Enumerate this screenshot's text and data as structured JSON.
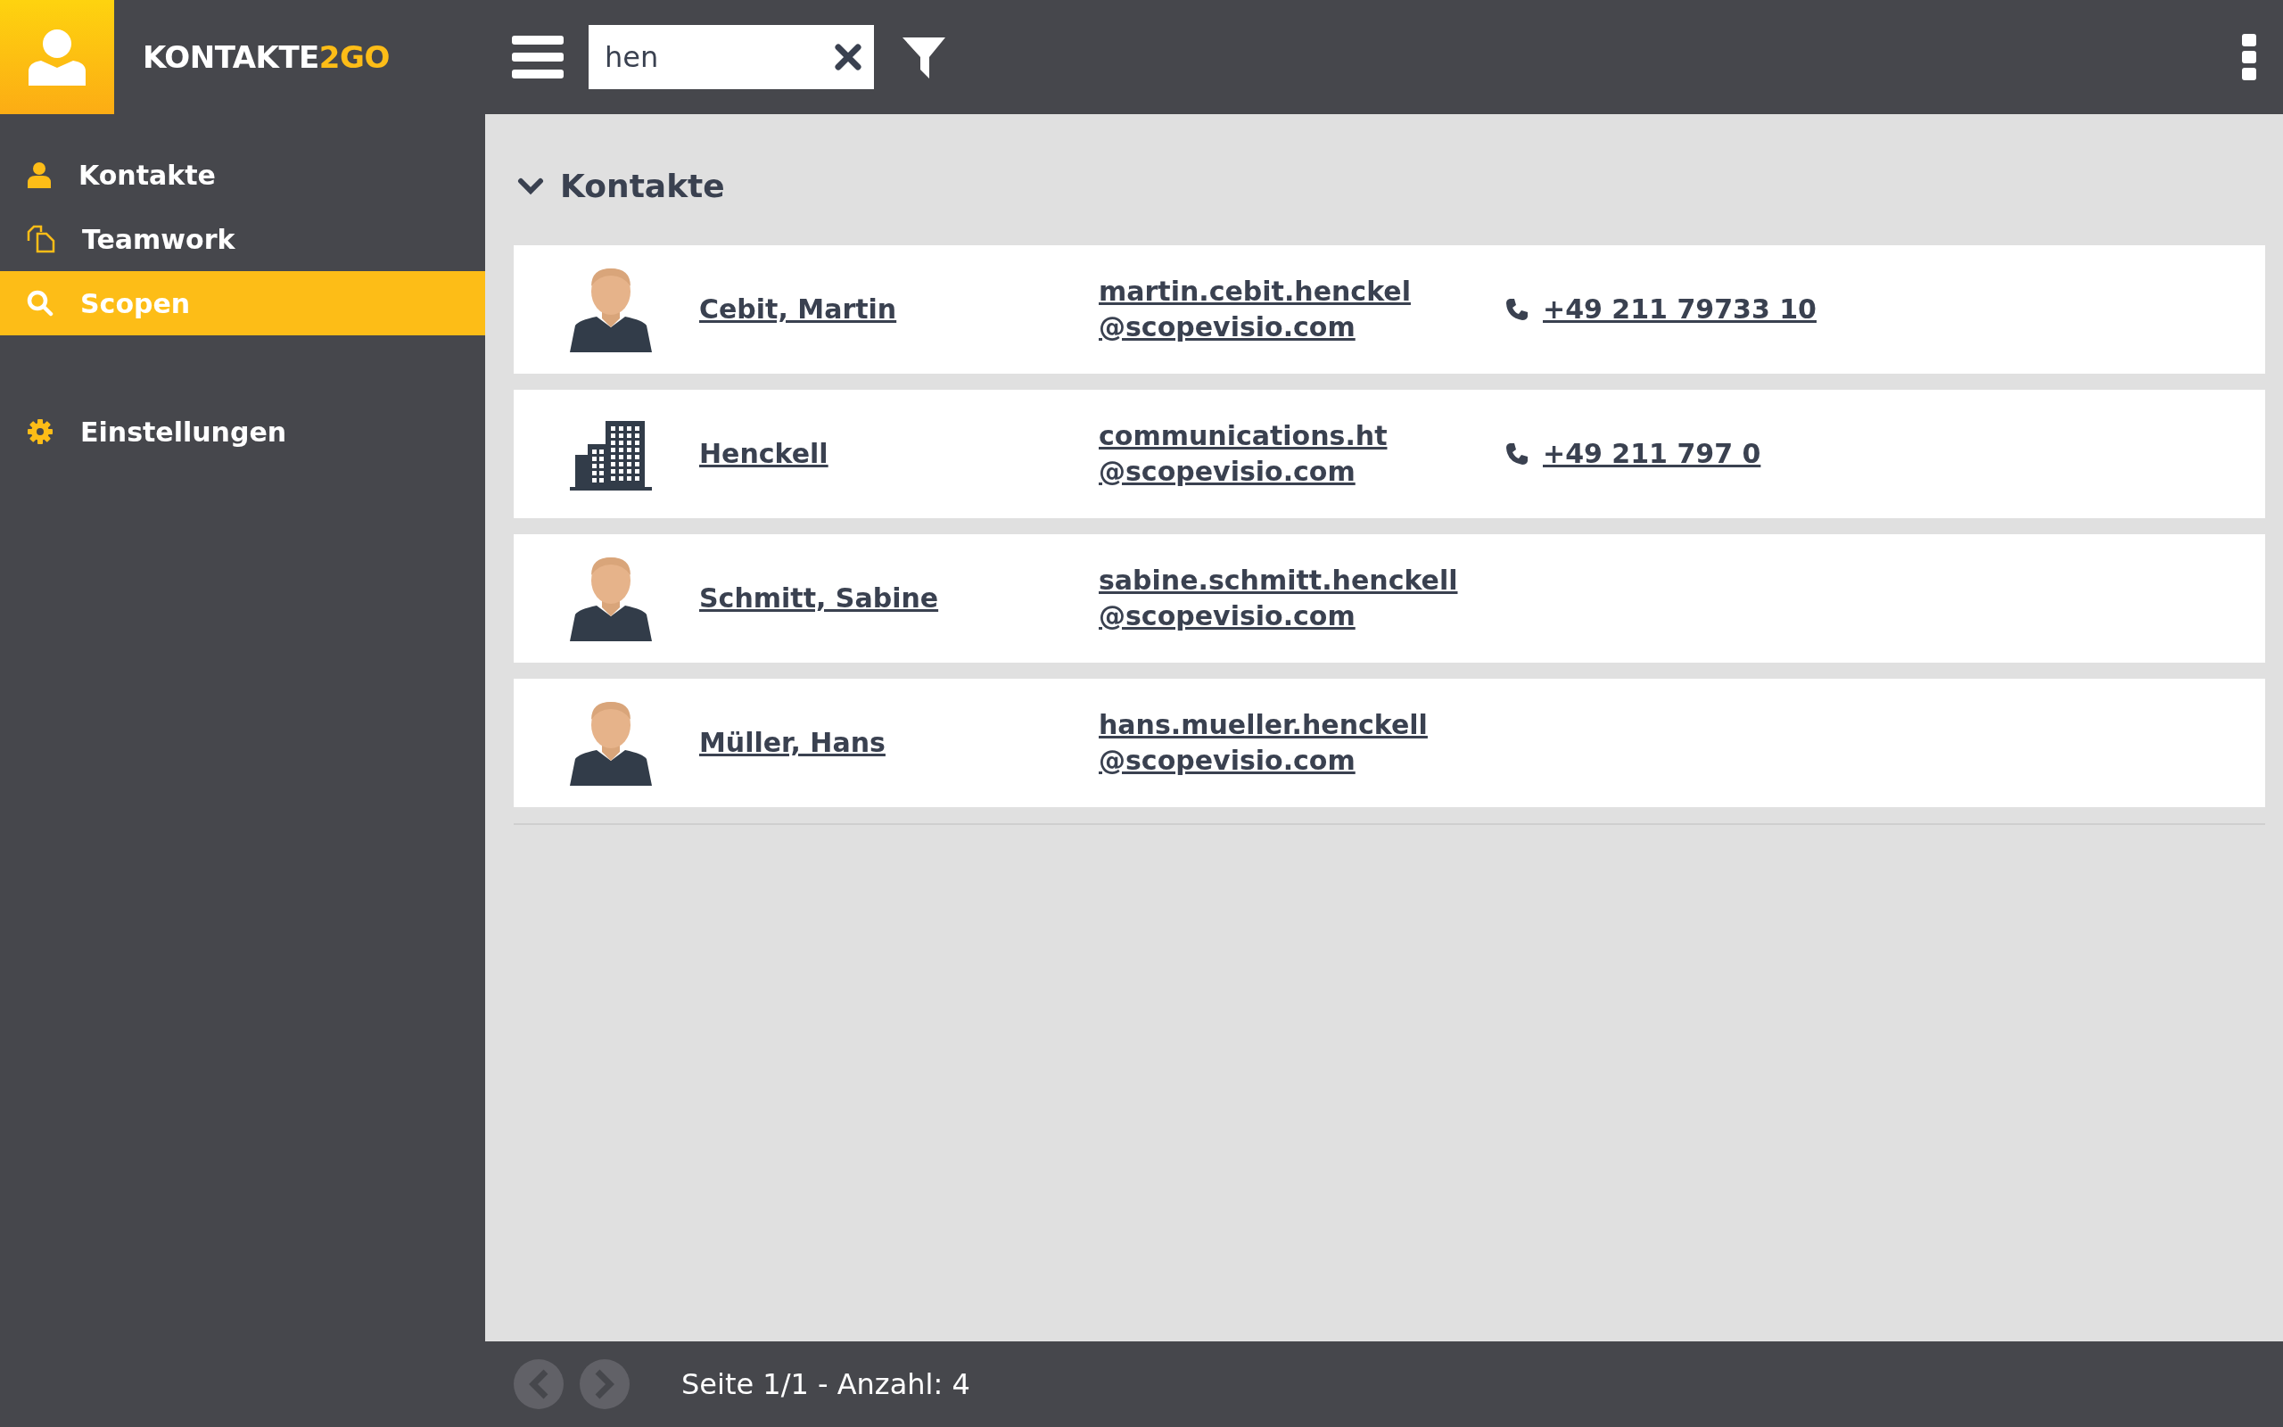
{
  "app": {
    "name": "KONTAKTE",
    "name_accent": "2GO"
  },
  "sidebar": {
    "items": [
      {
        "label": "Kontakte",
        "selected": false
      },
      {
        "label": "Teamwork",
        "selected": false
      },
      {
        "label": "Scopen",
        "selected": true
      },
      {
        "label": "Einstellungen",
        "selected": false,
        "separated": true
      }
    ]
  },
  "search": {
    "value": "hen"
  },
  "section": {
    "title": "Kontakte",
    "expanded": true
  },
  "contacts": [
    {
      "kind": "person",
      "name": "Cebit, Martin",
      "email": [
        "martin.cebit.henckel",
        "@scopevisio.com"
      ],
      "phone": "+49 211 79733 10"
    },
    {
      "kind": "company",
      "name": "Henckell",
      "email": [
        "communications.ht",
        "@scopevisio.com"
      ],
      "phone": "+49 211 797 0"
    },
    {
      "kind": "person",
      "name": "Schmitt, Sabine",
      "email": [
        "sabine.schmitt.henckell",
        "@scopevisio.com"
      ]
    },
    {
      "kind": "person",
      "name": "Müller, Hans",
      "email": [
        "hans.mueller.henckell",
        "@scopevisio.com"
      ]
    }
  ],
  "status_bar": {
    "text": "Seite 1/1 - Anzahl: 4"
  }
}
